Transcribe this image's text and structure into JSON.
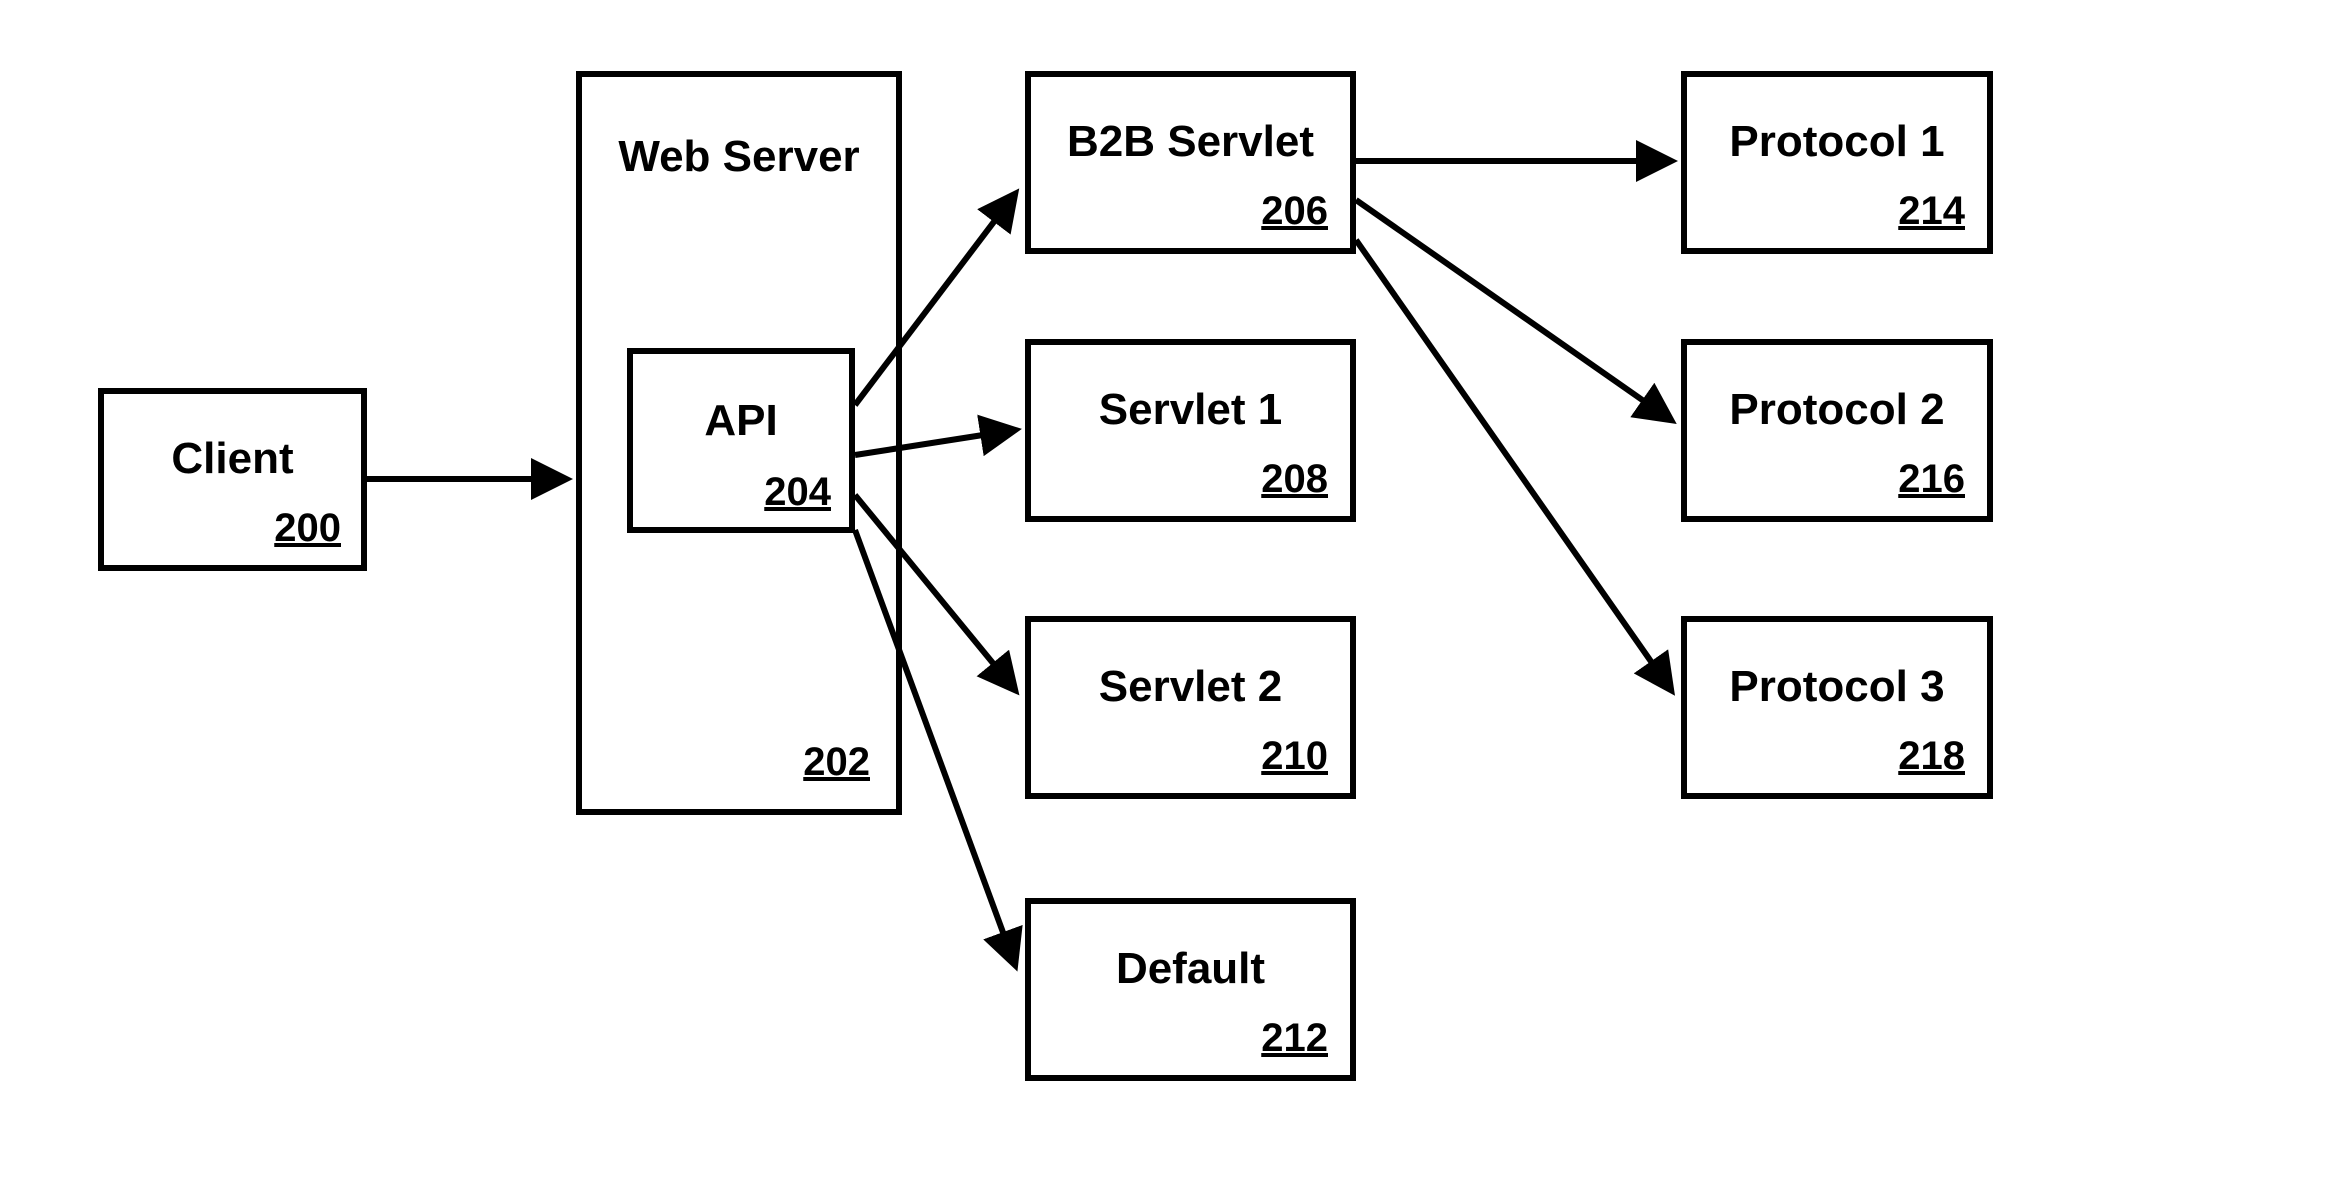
{
  "nodes": {
    "client": {
      "label": "Client",
      "ref": "200"
    },
    "webserver": {
      "label": "Web Server",
      "ref": "202"
    },
    "api": {
      "label": "API",
      "ref": "204"
    },
    "b2b": {
      "label": "B2B Servlet",
      "ref": "206"
    },
    "servlet1": {
      "label": "Servlet 1",
      "ref": "208"
    },
    "servlet2": {
      "label": "Servlet 2",
      "ref": "210"
    },
    "default": {
      "label": "Default",
      "ref": "212"
    },
    "protocol1": {
      "label": "Protocol 1",
      "ref": "214"
    },
    "protocol2": {
      "label": "Protocol 2",
      "ref": "216"
    },
    "protocol3": {
      "label": "Protocol 3",
      "ref": "218"
    }
  }
}
